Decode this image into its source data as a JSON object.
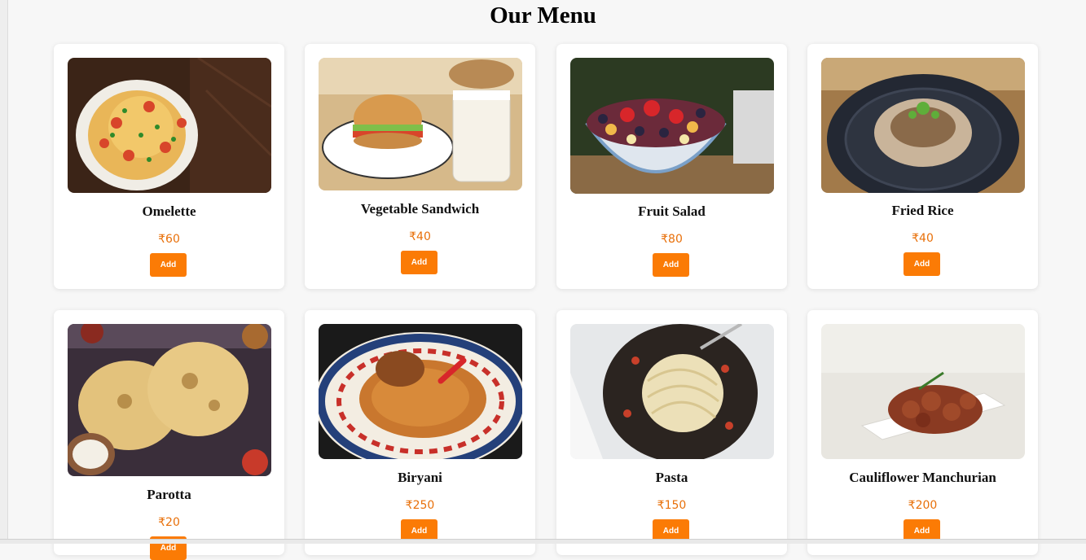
{
  "page": {
    "title": "Our Menu"
  },
  "items": [
    {
      "name": "Omelette",
      "price": "₹60",
      "button": "Add"
    },
    {
      "name": "Vegetable Sandwich",
      "price": "₹40",
      "button": "Add"
    },
    {
      "name": "Fruit Salad",
      "price": "₹80",
      "button": "Add"
    },
    {
      "name": "Fried Rice",
      "price": "₹40",
      "button": "Add"
    },
    {
      "name": "Parotta",
      "price": "₹20",
      "button": "Add"
    },
    {
      "name": "Biryani",
      "price": "₹250",
      "button": "Add"
    },
    {
      "name": "Pasta",
      "price": "₹150",
      "button": "Add"
    },
    {
      "name": "Cauliflower Manchurian",
      "price": "₹200",
      "button": "Add"
    }
  ]
}
